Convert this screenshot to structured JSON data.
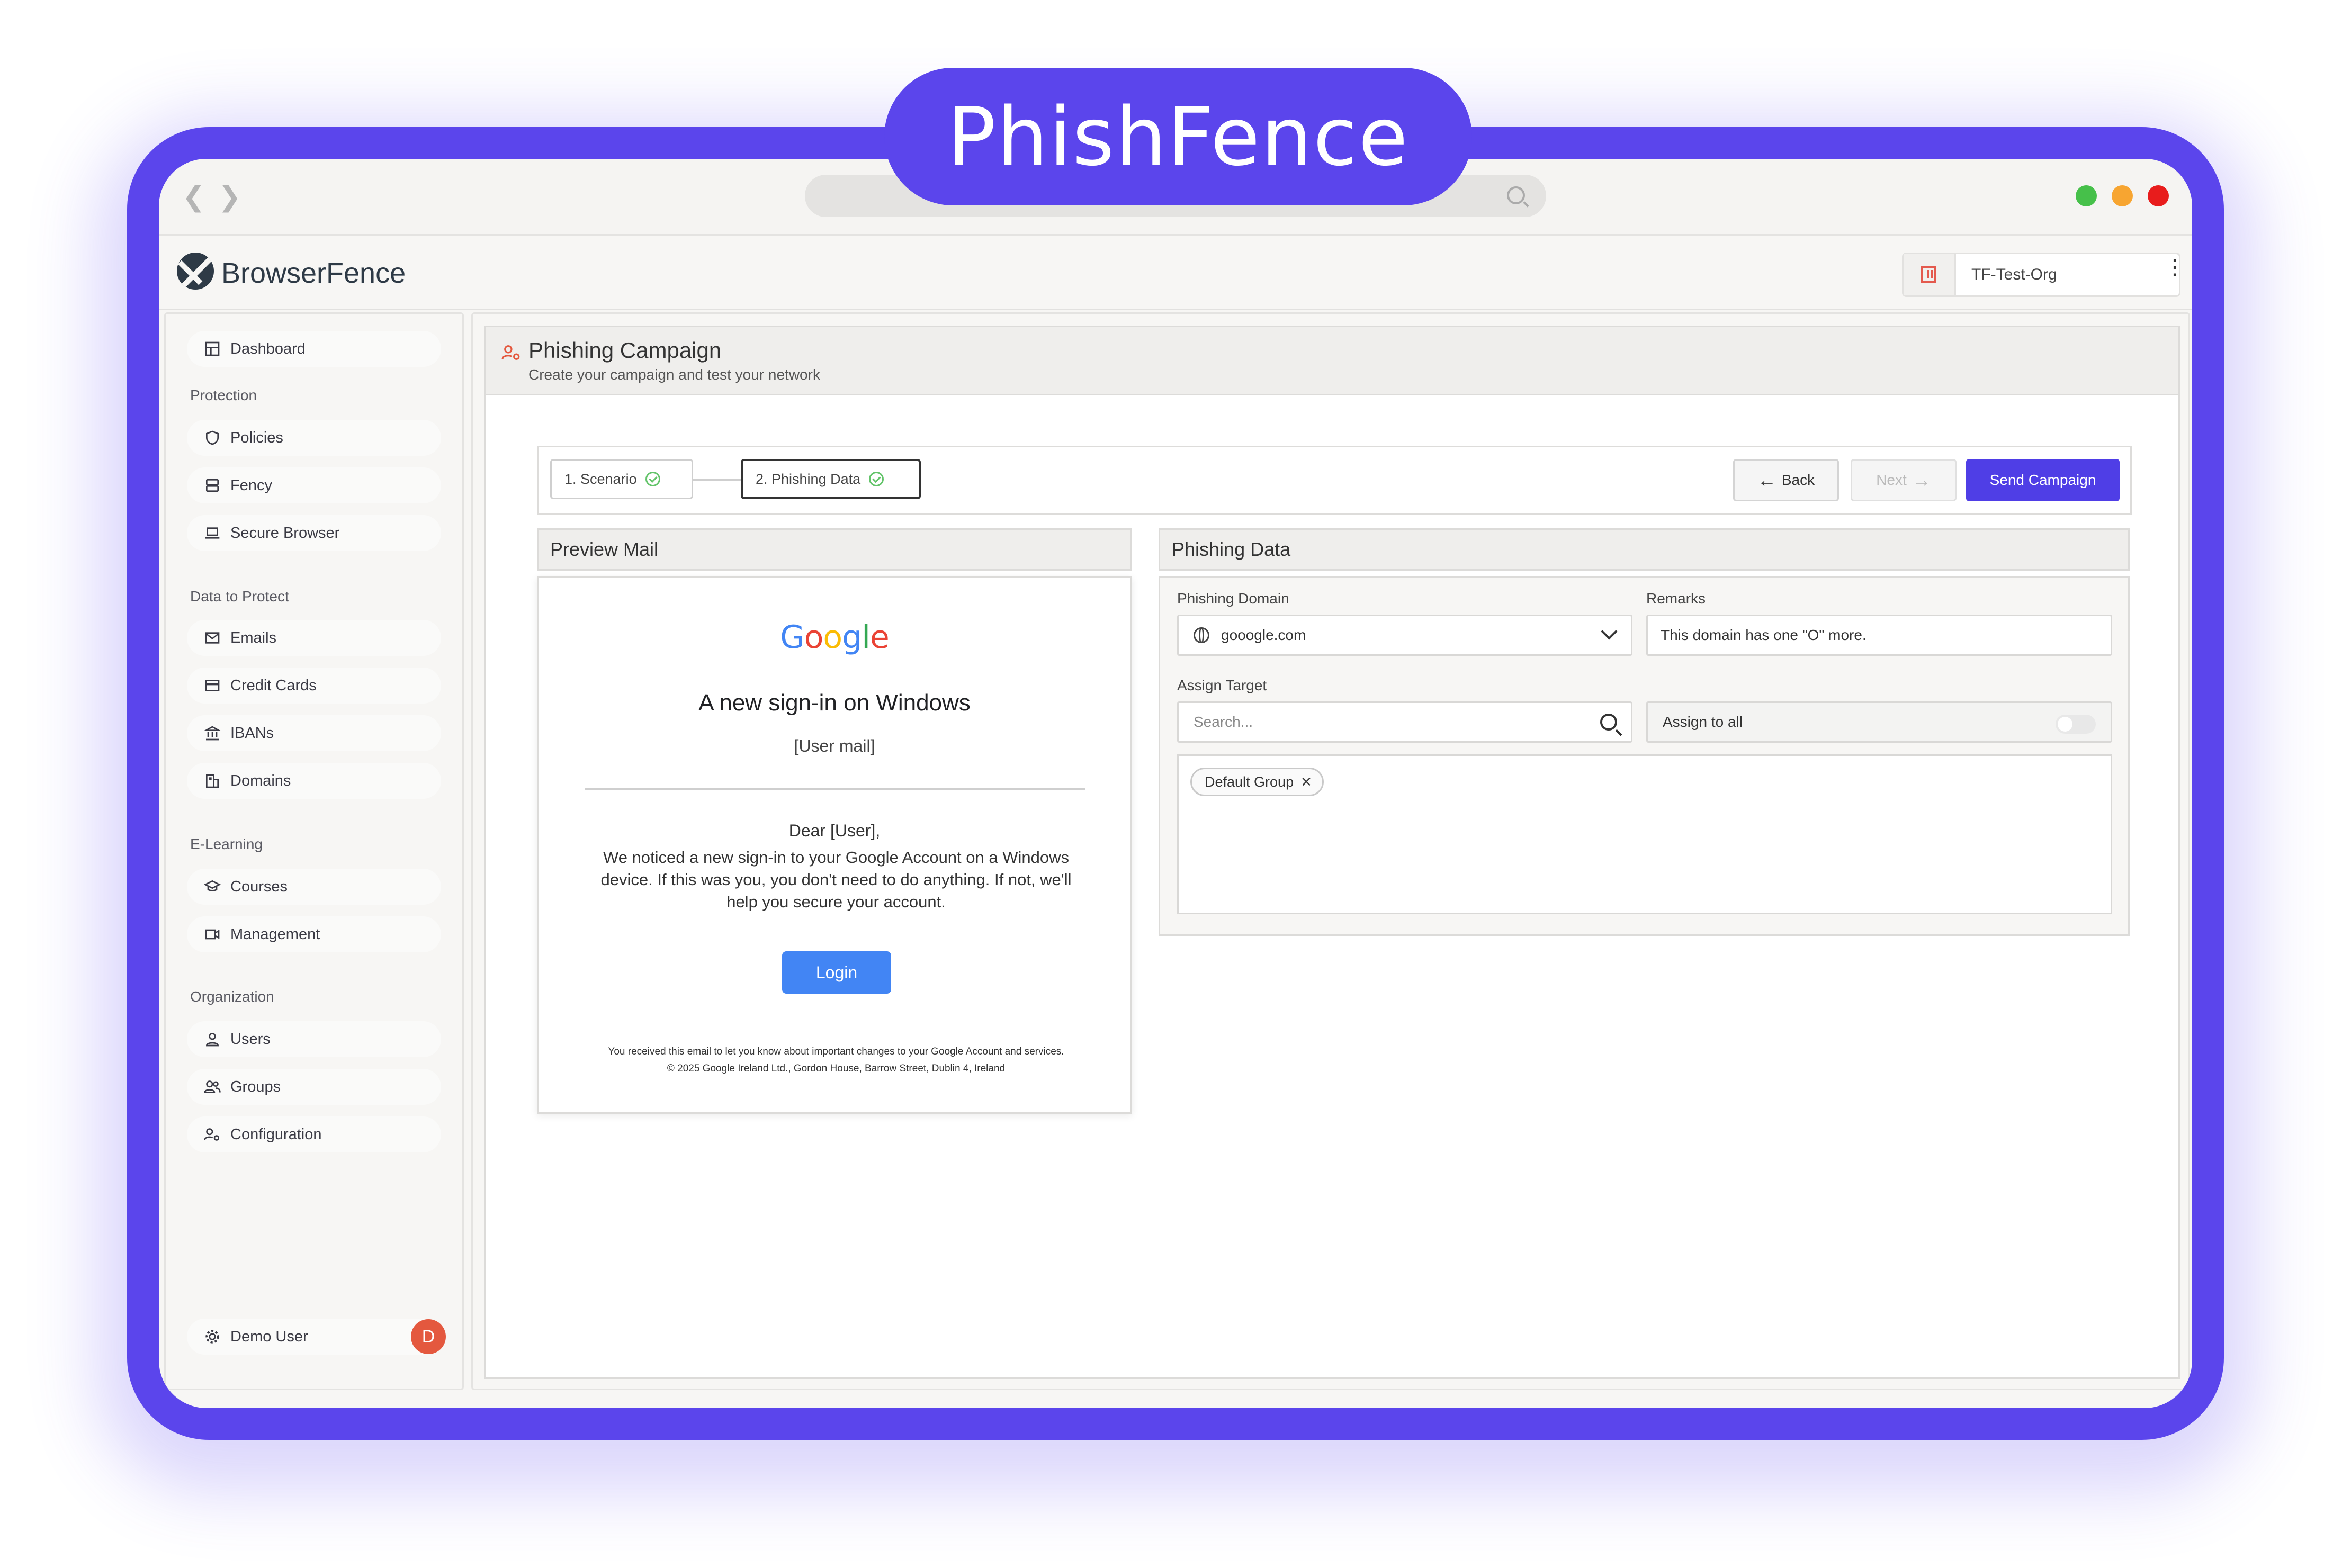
{
  "brand_badge": "PhishFence",
  "colors": {
    "frame": "#5b45ec",
    "accent": "#4f3ee6",
    "google_blue": "#4285f4",
    "avatar": "#e4583e",
    "traffic": [
      "#46c04a",
      "#f7a531",
      "#e81c1c"
    ]
  },
  "app": {
    "logo_text": "BrowserFence",
    "org_name": "TF-Test-Org"
  },
  "sidebar": {
    "dashboard": "Dashboard",
    "sections": [
      "Protection",
      "Data to Protect",
      "E-Learning",
      "Organization"
    ],
    "protection": [
      "Policies",
      "Fency",
      "Secure Browser"
    ],
    "data": [
      "Emails",
      "Credit Cards",
      "IBANs",
      "Domains"
    ],
    "elearning": [
      "Courses",
      "Management"
    ],
    "organization": [
      "Users",
      "Groups",
      "Configuration"
    ],
    "user_name": "Demo User",
    "avatar_initial": "D"
  },
  "page": {
    "title": "Phishing Campaign",
    "subtitle": "Create your campaign and test your network"
  },
  "steps": [
    "1. Scenario",
    "2. Phishing Data"
  ],
  "buttons": {
    "back": "Back",
    "next": "Next",
    "send": "Send Campaign"
  },
  "preview": {
    "header": "Preview Mail",
    "logo": [
      "G",
      "o",
      "o",
      "g",
      "l",
      "e"
    ],
    "title": "A new sign-in on Windows",
    "user_mail": "[User mail]",
    "dear": "Dear [User],",
    "body": "We noticed a new sign-in to your Google Account on a Windows device. If this was you, you don't need to do anything. If not, we'll help you secure your account.",
    "login_button": "Login",
    "footer_1": "You received this email to let you know about important changes to your Google Account and services.",
    "footer_2": "© 2025 Google Ireland Ltd., Gordon House, Barrow Street, Dublin 4, Ireland"
  },
  "phishing_data": {
    "header": "Phishing Data",
    "domain_label": "Phishing Domain",
    "domain_value": "gooogle.com",
    "remarks_label": "Remarks",
    "remarks_value": "This domain has one \"O\" more.",
    "assign_label": "Assign Target",
    "search_placeholder": "Search...",
    "assign_all_label": "Assign to all",
    "assign_all_on": false,
    "tags": [
      "Default Group"
    ]
  }
}
